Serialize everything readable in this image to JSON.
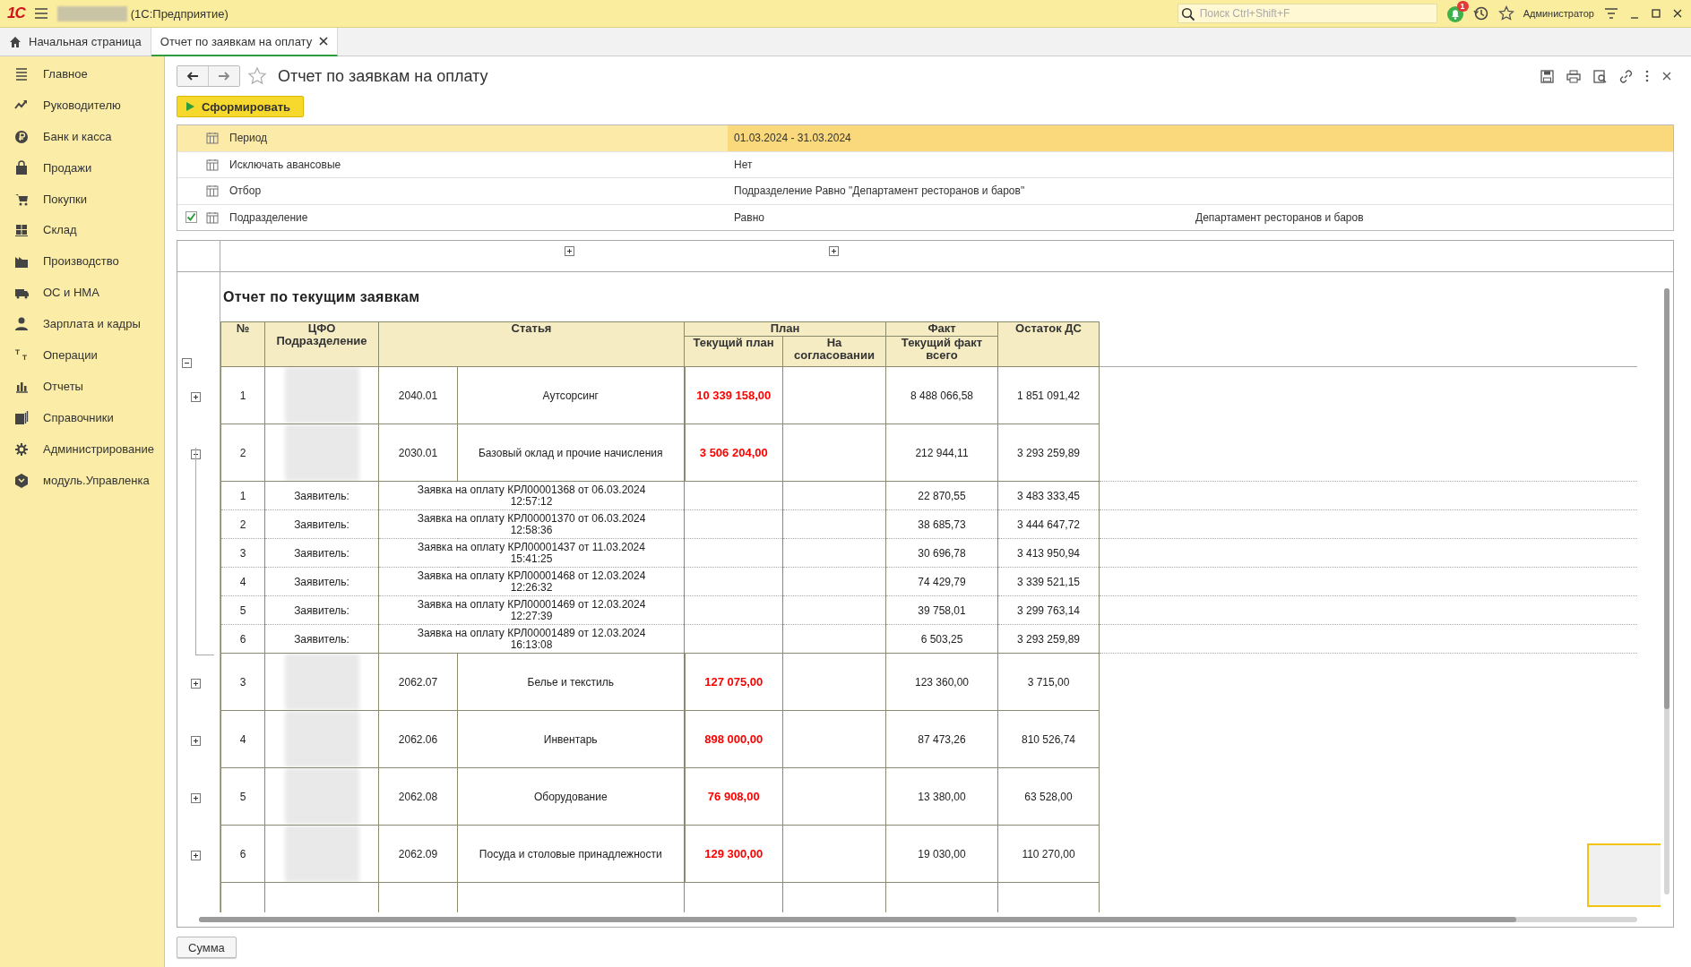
{
  "app": {
    "logo": "1С",
    "title": "(1С:Предприятие)",
    "search": {
      "placeholder": "Поиск Ctrl+Shift+F"
    },
    "notification_count": "1",
    "user": "Администратор"
  },
  "tabs": [
    {
      "label": "Начальная страница",
      "selected": false
    },
    {
      "label": "Отчет по заявкам на оплату",
      "selected": true
    }
  ],
  "sidebar": {
    "items": [
      {
        "label": "Главное"
      },
      {
        "label": "Руководителю"
      },
      {
        "label": "Банк и касса"
      },
      {
        "label": "Продажи"
      },
      {
        "label": "Покупки"
      },
      {
        "label": "Склад"
      },
      {
        "label": "Производство"
      },
      {
        "label": "ОС и НМА"
      },
      {
        "label": "Зарплата и кадры"
      },
      {
        "label": "Операции"
      },
      {
        "label": "Отчеты"
      },
      {
        "label": "Справочники"
      },
      {
        "label": "Администрирование"
      },
      {
        "label": "модуль.Управленка"
      }
    ]
  },
  "form": {
    "title": "Отчет по заявкам на оплату",
    "favorite": false,
    "generate_button": "Сформировать",
    "params": [
      {
        "name": "Период",
        "value": "01.03.2024 - 31.03.2024",
        "selected": true
      },
      {
        "name": "Исключать авансовые",
        "value": "Нет",
        "selected": false
      },
      {
        "name": "Отбор",
        "value": "Подразделение Равно \"Департамент ресторанов и баров\"",
        "selected": false
      },
      {
        "name": "Подразделение",
        "value": "Равно",
        "value_2": "Департамент ресторанов и баров",
        "selected": false,
        "checked": true
      }
    ],
    "report": {
      "title": "Отчет по текущим заявкам",
      "expanded": true,
      "column_groups": [
        {
          "expanded": false
        },
        {
          "expanded": false
        }
      ],
      "header": {
        "number": "№",
        "cfo": "ЦФО Подразделение",
        "article": "Статья",
        "plan": "План",
        "plan_current": "Текущий план",
        "plan_pending": "На согласовании",
        "fact": "Факт",
        "fact_current": "Текущий факт всего",
        "balance": "Остаток ДС"
      },
      "rows": [
        {
          "number": "1",
          "expanded": false,
          "code": "2040.01",
          "article": "Аутсорсинг",
          "plan": "10 339 158,00",
          "fact": "8 488 066,58",
          "balance": "1 851 091,42"
        },
        {
          "number": "2",
          "expanded": true,
          "code": "2030.01",
          "article": "Базовый оклад и прочие начисления",
          "plan": "3 506 204,00",
          "fact": "212 944,11",
          "balance": "3 293 259,89",
          "children": [
            {
              "number": "1",
              "applicant": "Заявитель:",
              "document": "Заявка на оплату КРЛ00001368 от 06.03.2024 12:57:12",
              "fact": "22 870,55",
              "balance": "3 483 333,45"
            },
            {
              "number": "2",
              "applicant": "Заявитель:",
              "document": "Заявка на оплату КРЛ00001370 от 06.03.2024 12:58:36",
              "fact": "38 685,73",
              "balance": "3 444 647,72"
            },
            {
              "number": "3",
              "applicant": "Заявитель:",
              "document": "Заявка на оплату КРЛ00001437 от 11.03.2024 15:41:25",
              "fact": "30 696,78",
              "balance": "3 413 950,94"
            },
            {
              "number": "4",
              "applicant": "Заявитель:",
              "document": "Заявка на оплату КРЛ00001468 от 12.03.2024 12:26:32",
              "fact": "74 429,79",
              "balance": "3 339 521,15"
            },
            {
              "number": "5",
              "applicant": "Заявитель:",
              "document": "Заявка на оплату КРЛ00001469 от 12.03.2024 12:27:39",
              "fact": "39 758,01",
              "balance": "3 299 763,14"
            },
            {
              "number": "6",
              "applicant": "Заявитель:",
              "document": "Заявка на оплату КРЛ00001489 от 12.03.2024 16:13:08",
              "fact": "6 503,25",
              "balance": "3 293 259,89"
            }
          ]
        },
        {
          "number": "3",
          "expanded": false,
          "code": "2062.07",
          "article": "Белье и текстиль",
          "plan": "127 075,00",
          "fact": "123 360,00",
          "balance": "3 715,00"
        },
        {
          "number": "4",
          "expanded": false,
          "code": "2062.06",
          "article": "Инвентарь",
          "plan": "898 000,00",
          "fact": "87 473,26",
          "balance": "810 526,74"
        },
        {
          "number": "5",
          "expanded": false,
          "code": "2062.08",
          "article": "Оборудование",
          "plan": "76 908,00",
          "fact": "13 380,00",
          "balance": "63 528,00"
        },
        {
          "number": "6",
          "expanded": false,
          "code": "2062.09",
          "article": "Посуда и столовые принадлежности",
          "plan": "129 300,00",
          "fact": "19 030,00",
          "balance": "110 270,00"
        }
      ]
    },
    "sum_button": "Сумма"
  }
}
